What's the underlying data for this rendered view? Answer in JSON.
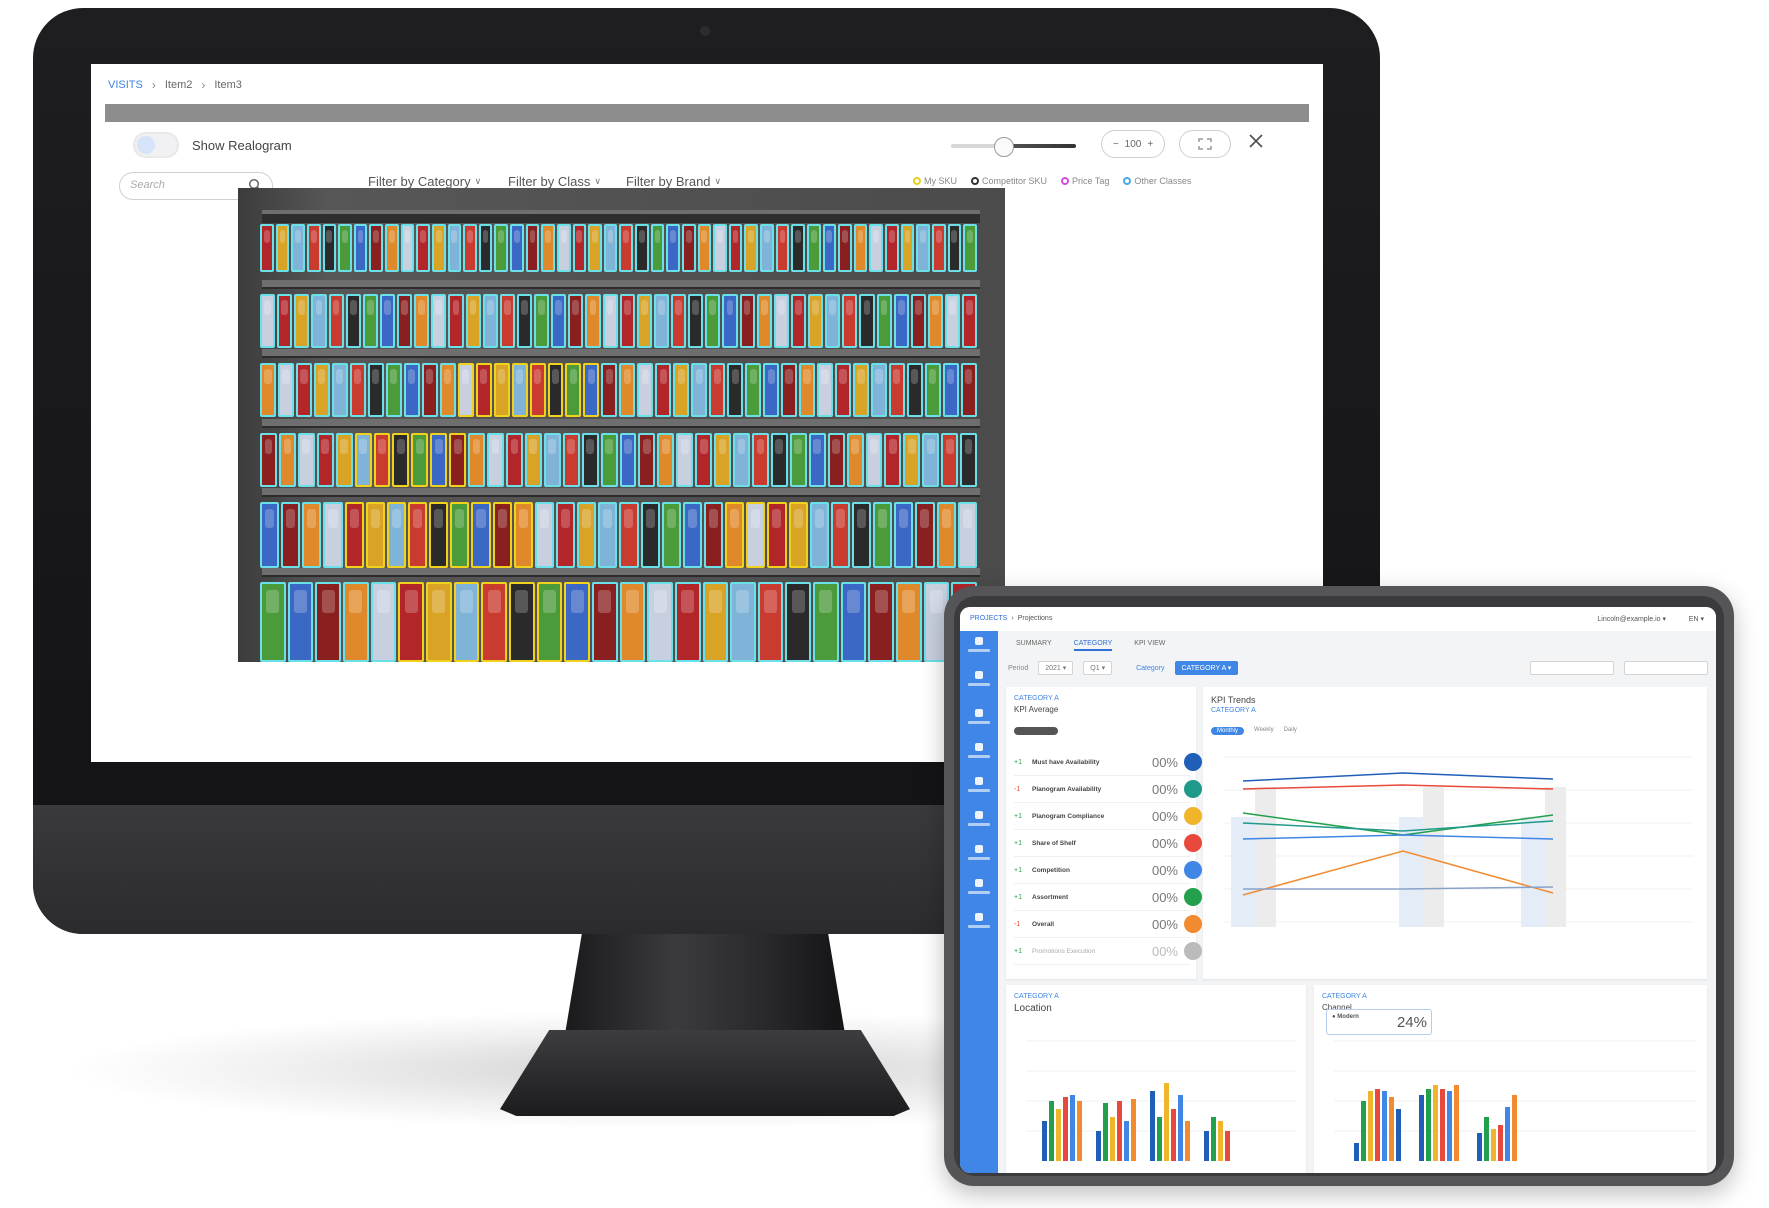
{
  "monitor": {
    "breadcrumb": [
      "VISITS",
      "Item2",
      "Item3"
    ],
    "realogram_label": "Show Realogram",
    "zoom": "100",
    "search_placeholder": "Search",
    "filters": [
      "Filter by Category",
      "Filter by Class",
      "Filter by Brand"
    ],
    "legend": [
      {
        "label": "My SKU",
        "color": "#e8cf1a"
      },
      {
        "label": "Competitor SKU",
        "color": "#333333"
      },
      {
        "label": "Price Tag",
        "color": "#d44fd8"
      },
      {
        "label": "Other Classes",
        "color": "#4aa7e8"
      }
    ],
    "annotation_colors": {
      "my_sku": "#f0d21c",
      "other": "#6ae0e8"
    }
  },
  "tablet": {
    "breadcrumb": [
      "PROJECTS",
      "Projections"
    ],
    "user": "Lincoln@example.io",
    "lang": "EN",
    "tabs": [
      "SUMMARY",
      "CATEGORY",
      "KPI VIEW"
    ],
    "active_tab": "CATEGORY",
    "period_label": "Period",
    "period_year": "2021",
    "period_q": "Q1",
    "category_label": "Category",
    "category_value": "CATEGORY A",
    "kpi_card": {
      "category": "CATEGORY A",
      "title": "KPI Average",
      "rows": [
        {
          "name": "Must have Availability",
          "value": "00%",
          "trend": "+1",
          "color": "#1f5fb8"
        },
        {
          "name": "Planogram Availability",
          "value": "00%",
          "trend": "-1",
          "color": "#1f9a8a"
        },
        {
          "name": "Planogram Compliance",
          "value": "00%",
          "trend": "+1",
          "color": "#f0b52a"
        },
        {
          "name": "Share of Shelf",
          "value": "00%",
          "trend": "+1",
          "color": "#e8493c"
        },
        {
          "name": "Competition",
          "value": "00%",
          "trend": "+1",
          "color": "#3f86e6"
        },
        {
          "name": "Assortment",
          "value": "00%",
          "trend": "+1",
          "color": "#22a04b"
        },
        {
          "name": "Overall",
          "value": "00%",
          "trend": "-1",
          "color": "#f28a30"
        },
        {
          "name": "Promotions Execution",
          "value": "00%",
          "trend": "+1",
          "color": "#bbbbbb"
        }
      ]
    },
    "trend_card": {
      "title": "KPI Trends",
      "category": "CATEGORY A",
      "pills": [
        "Monthly",
        "Weekly",
        "Daily"
      ]
    },
    "location_card": {
      "category": "CATEGORY A",
      "title": "Location"
    },
    "channel_card": {
      "category": "CATEGORY A",
      "title": "Channel",
      "bubble_label": "Modern",
      "bubble_value": "24%"
    }
  }
}
